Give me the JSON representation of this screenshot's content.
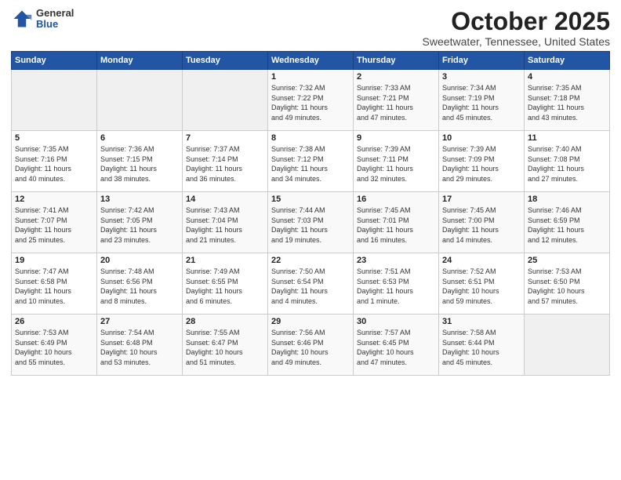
{
  "logo": {
    "general": "General",
    "blue": "Blue"
  },
  "title": "October 2025",
  "subtitle": "Sweetwater, Tennessee, United States",
  "weekdays": [
    "Sunday",
    "Monday",
    "Tuesday",
    "Wednesday",
    "Thursday",
    "Friday",
    "Saturday"
  ],
  "weeks": [
    [
      {
        "day": "",
        "info": ""
      },
      {
        "day": "",
        "info": ""
      },
      {
        "day": "",
        "info": ""
      },
      {
        "day": "1",
        "info": "Sunrise: 7:32 AM\nSunset: 7:22 PM\nDaylight: 11 hours\nand 49 minutes."
      },
      {
        "day": "2",
        "info": "Sunrise: 7:33 AM\nSunset: 7:21 PM\nDaylight: 11 hours\nand 47 minutes."
      },
      {
        "day": "3",
        "info": "Sunrise: 7:34 AM\nSunset: 7:19 PM\nDaylight: 11 hours\nand 45 minutes."
      },
      {
        "day": "4",
        "info": "Sunrise: 7:35 AM\nSunset: 7:18 PM\nDaylight: 11 hours\nand 43 minutes."
      }
    ],
    [
      {
        "day": "5",
        "info": "Sunrise: 7:35 AM\nSunset: 7:16 PM\nDaylight: 11 hours\nand 40 minutes."
      },
      {
        "day": "6",
        "info": "Sunrise: 7:36 AM\nSunset: 7:15 PM\nDaylight: 11 hours\nand 38 minutes."
      },
      {
        "day": "7",
        "info": "Sunrise: 7:37 AM\nSunset: 7:14 PM\nDaylight: 11 hours\nand 36 minutes."
      },
      {
        "day": "8",
        "info": "Sunrise: 7:38 AM\nSunset: 7:12 PM\nDaylight: 11 hours\nand 34 minutes."
      },
      {
        "day": "9",
        "info": "Sunrise: 7:39 AM\nSunset: 7:11 PM\nDaylight: 11 hours\nand 32 minutes."
      },
      {
        "day": "10",
        "info": "Sunrise: 7:39 AM\nSunset: 7:09 PM\nDaylight: 11 hours\nand 29 minutes."
      },
      {
        "day": "11",
        "info": "Sunrise: 7:40 AM\nSunset: 7:08 PM\nDaylight: 11 hours\nand 27 minutes."
      }
    ],
    [
      {
        "day": "12",
        "info": "Sunrise: 7:41 AM\nSunset: 7:07 PM\nDaylight: 11 hours\nand 25 minutes."
      },
      {
        "day": "13",
        "info": "Sunrise: 7:42 AM\nSunset: 7:05 PM\nDaylight: 11 hours\nand 23 minutes."
      },
      {
        "day": "14",
        "info": "Sunrise: 7:43 AM\nSunset: 7:04 PM\nDaylight: 11 hours\nand 21 minutes."
      },
      {
        "day": "15",
        "info": "Sunrise: 7:44 AM\nSunset: 7:03 PM\nDaylight: 11 hours\nand 19 minutes."
      },
      {
        "day": "16",
        "info": "Sunrise: 7:45 AM\nSunset: 7:01 PM\nDaylight: 11 hours\nand 16 minutes."
      },
      {
        "day": "17",
        "info": "Sunrise: 7:45 AM\nSunset: 7:00 PM\nDaylight: 11 hours\nand 14 minutes."
      },
      {
        "day": "18",
        "info": "Sunrise: 7:46 AM\nSunset: 6:59 PM\nDaylight: 11 hours\nand 12 minutes."
      }
    ],
    [
      {
        "day": "19",
        "info": "Sunrise: 7:47 AM\nSunset: 6:58 PM\nDaylight: 11 hours\nand 10 minutes."
      },
      {
        "day": "20",
        "info": "Sunrise: 7:48 AM\nSunset: 6:56 PM\nDaylight: 11 hours\nand 8 minutes."
      },
      {
        "day": "21",
        "info": "Sunrise: 7:49 AM\nSunset: 6:55 PM\nDaylight: 11 hours\nand 6 minutes."
      },
      {
        "day": "22",
        "info": "Sunrise: 7:50 AM\nSunset: 6:54 PM\nDaylight: 11 hours\nand 4 minutes."
      },
      {
        "day": "23",
        "info": "Sunrise: 7:51 AM\nSunset: 6:53 PM\nDaylight: 11 hours\nand 1 minute."
      },
      {
        "day": "24",
        "info": "Sunrise: 7:52 AM\nSunset: 6:51 PM\nDaylight: 10 hours\nand 59 minutes."
      },
      {
        "day": "25",
        "info": "Sunrise: 7:53 AM\nSunset: 6:50 PM\nDaylight: 10 hours\nand 57 minutes."
      }
    ],
    [
      {
        "day": "26",
        "info": "Sunrise: 7:53 AM\nSunset: 6:49 PM\nDaylight: 10 hours\nand 55 minutes."
      },
      {
        "day": "27",
        "info": "Sunrise: 7:54 AM\nSunset: 6:48 PM\nDaylight: 10 hours\nand 53 minutes."
      },
      {
        "day": "28",
        "info": "Sunrise: 7:55 AM\nSunset: 6:47 PM\nDaylight: 10 hours\nand 51 minutes."
      },
      {
        "day": "29",
        "info": "Sunrise: 7:56 AM\nSunset: 6:46 PM\nDaylight: 10 hours\nand 49 minutes."
      },
      {
        "day": "30",
        "info": "Sunrise: 7:57 AM\nSunset: 6:45 PM\nDaylight: 10 hours\nand 47 minutes."
      },
      {
        "day": "31",
        "info": "Sunrise: 7:58 AM\nSunset: 6:44 PM\nDaylight: 10 hours\nand 45 minutes."
      },
      {
        "day": "",
        "info": ""
      }
    ]
  ]
}
